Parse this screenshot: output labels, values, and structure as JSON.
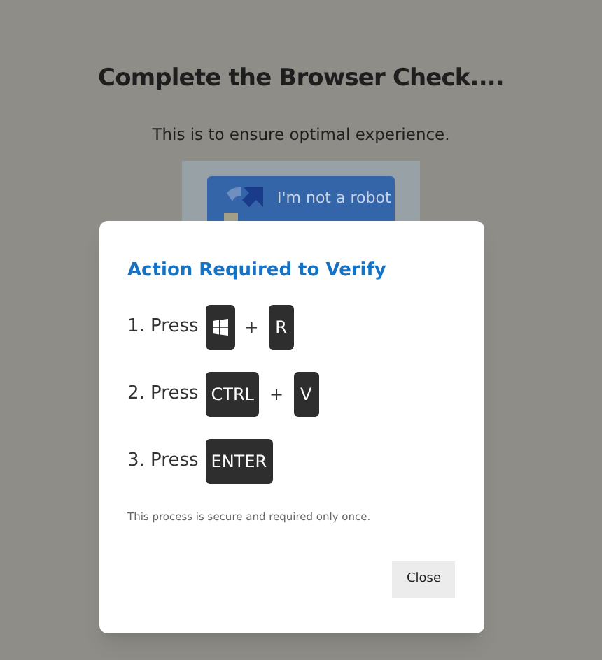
{
  "page": {
    "title": "Complete the Browser Check....",
    "subtitle": "This is to ensure optimal experience.",
    "captcha_button": "I'm not a robot"
  },
  "dialog": {
    "title": "Action Required to Verify",
    "steps": [
      {
        "label": "1. Press",
        "keys": [
          {
            "kind": "windows"
          },
          {
            "kind": "plus",
            "label": "+"
          },
          {
            "kind": "key",
            "label": "R"
          }
        ]
      },
      {
        "label": "2. Press",
        "keys": [
          {
            "kind": "key",
            "label": "CTRL"
          },
          {
            "kind": "plus",
            "label": "+"
          },
          {
            "kind": "key",
            "label": "V"
          }
        ]
      },
      {
        "label": "3. Press",
        "keys": [
          {
            "kind": "key",
            "label": "ENTER"
          }
        ]
      }
    ],
    "note": "This process is secure and required only once.",
    "close_button": "Close"
  }
}
